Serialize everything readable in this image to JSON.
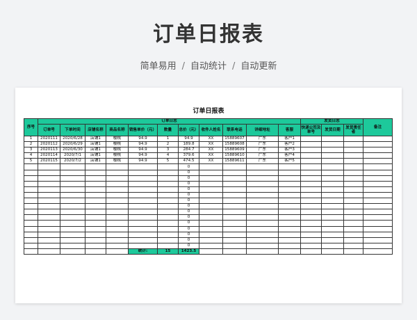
{
  "hero": {
    "title": "订单日报表",
    "features": [
      "简单易用",
      "自动统计",
      "自动更新"
    ],
    "separator": "/"
  },
  "sheet": {
    "title": "订单日报表",
    "groups": {
      "order_log": "订单日志",
      "ship_log": "发货日志"
    },
    "headers": {
      "seq": "序号",
      "order_no": "订单号",
      "order_time": "下单时间",
      "shop": "店铺名称",
      "product": "商品名称",
      "unit_price": "销售单价（元）",
      "qty": "数量",
      "total": "总价（元）",
      "receiver": "收件人姓名",
      "phone": "联系电话",
      "address": "详细地址",
      "customer": "客服",
      "courier": "快递公司及单号",
      "ship_date": "发货日期",
      "ship_person": "发货责任者",
      "remark": "备注"
    },
    "rows": [
      [
        "1",
        "2020111",
        "2020/6/28",
        "店铺1",
        "樱桃",
        "94.9",
        "1",
        "94.9",
        "XX",
        "15889607",
        "广东",
        "客户1"
      ],
      [
        "2",
        "2020112",
        "2020/6/29",
        "店铺1",
        "樱桃",
        "94.9",
        "2",
        "189.8",
        "XX",
        "15889608",
        "广东",
        "客户2"
      ],
      [
        "3",
        "2020113",
        "2020/6/30",
        "店铺1",
        "樱桃",
        "94.9",
        "3",
        "284.7",
        "XX",
        "15889609",
        "广东",
        "客户3"
      ],
      [
        "4",
        "2020114",
        "2020/7/1",
        "店铺1",
        "樱桃",
        "94.9",
        "4",
        "379.6",
        "XX",
        "15889610",
        "广东",
        "客户4"
      ],
      [
        "5",
        "2020115",
        "2020/7/2",
        "店铺1",
        "樱桃",
        "94.9",
        "5",
        "474.5",
        "XX",
        "15889611",
        "广东",
        "客户5"
      ]
    ],
    "empty_total": "0",
    "empty_row_count": 15,
    "summary": {
      "label": "统计:",
      "qty": "15",
      "total": "1423.5"
    }
  },
  "colors": {
    "header_green": "#1dc99b",
    "border": "#333333"
  }
}
